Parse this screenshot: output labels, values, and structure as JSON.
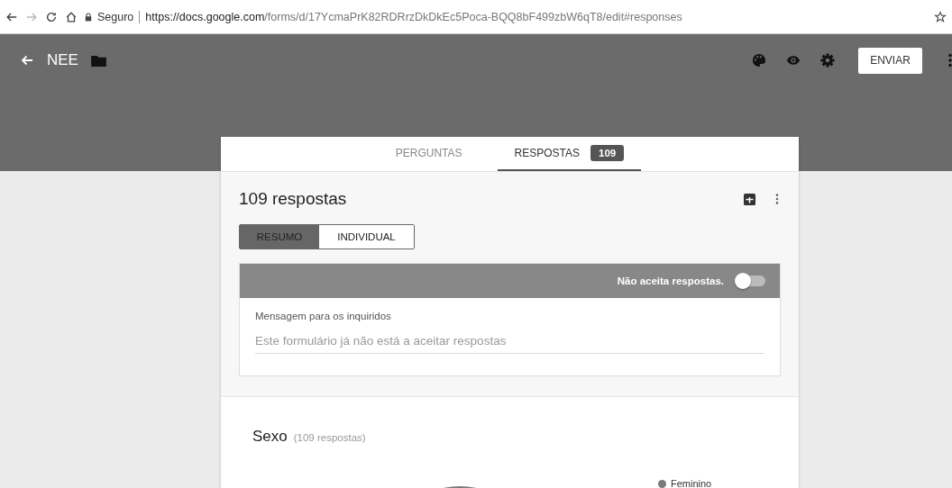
{
  "browser": {
    "security_label": "Seguro",
    "url_host": "https://docs.google.com",
    "url_path": "/forms/d/17YcmaPrK82RDRrzDkDkEc5Poca-BQQ8bF499zbW6qT8/edit#responses"
  },
  "header": {
    "title": "NEE",
    "send_button": "ENVIAR"
  },
  "tabs": [
    {
      "label": "PERGUNTAS",
      "selected": false
    },
    {
      "label": "RESPOSTAS",
      "selected": true,
      "badge": "109"
    }
  ],
  "responses": {
    "title": "109 respostas",
    "views": [
      {
        "label": "RESUMO",
        "selected": true
      },
      {
        "label": "INDIVIDUAL",
        "selected": false
      }
    ],
    "accepting": {
      "label": "Não aceita respostas.",
      "on": false
    },
    "message": {
      "label": "Mensagem para os inquiridos",
      "placeholder": "Este formulário já não está a aceitar respostas"
    }
  },
  "question": {
    "title": "Sexo",
    "count": "(109 respostas)",
    "legend": [
      {
        "label": "Feminino",
        "color": "#7a7a7a"
      }
    ]
  }
}
